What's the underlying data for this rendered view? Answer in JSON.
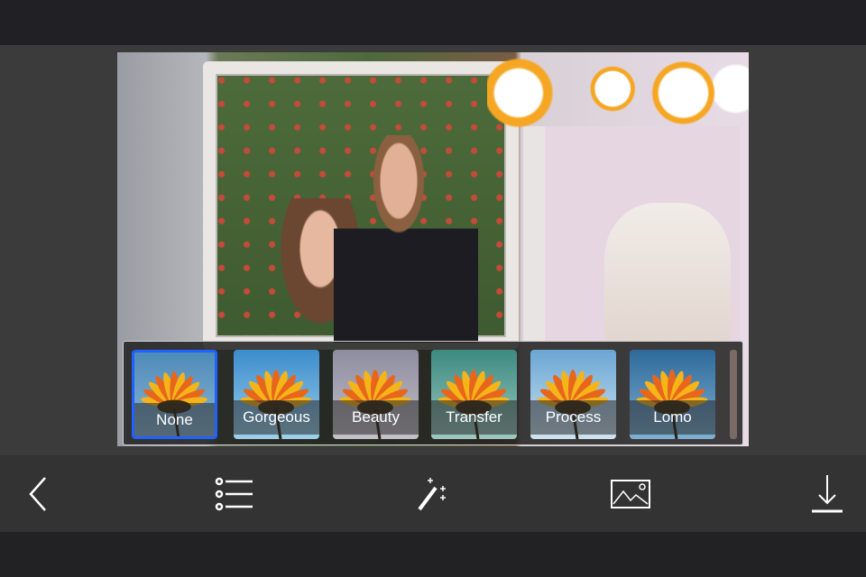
{
  "filters": [
    {
      "label": "None",
      "selected": true,
      "sky": [
        "#4e8ab8",
        "#8bb7d6"
      ]
    },
    {
      "label": "Gorgeous",
      "selected": false,
      "sky": [
        "#3c8ccc",
        "#9cd0ea"
      ]
    },
    {
      "label": "Beauty",
      "selected": false,
      "sky": [
        "#8e8da0",
        "#c4c0c8"
      ]
    },
    {
      "label": "Transfer",
      "selected": false,
      "sky": [
        "#3c8a80",
        "#9cc8c0"
      ]
    },
    {
      "label": "Process",
      "selected": false,
      "sky": [
        "#6aa6d4",
        "#cfe2f0"
      ]
    },
    {
      "label": "Lomo",
      "selected": false,
      "sky": [
        "#2e6a9a",
        "#7eb0d4"
      ]
    }
  ],
  "toolbar": {
    "icons": [
      "back-chevron-icon",
      "list-icon",
      "magic-wand-icon",
      "image-icon",
      "download-icon"
    ]
  },
  "colors": {
    "accent": "#1f62ff",
    "toolbar_bg": "#333333",
    "top_bg": "#212125"
  }
}
